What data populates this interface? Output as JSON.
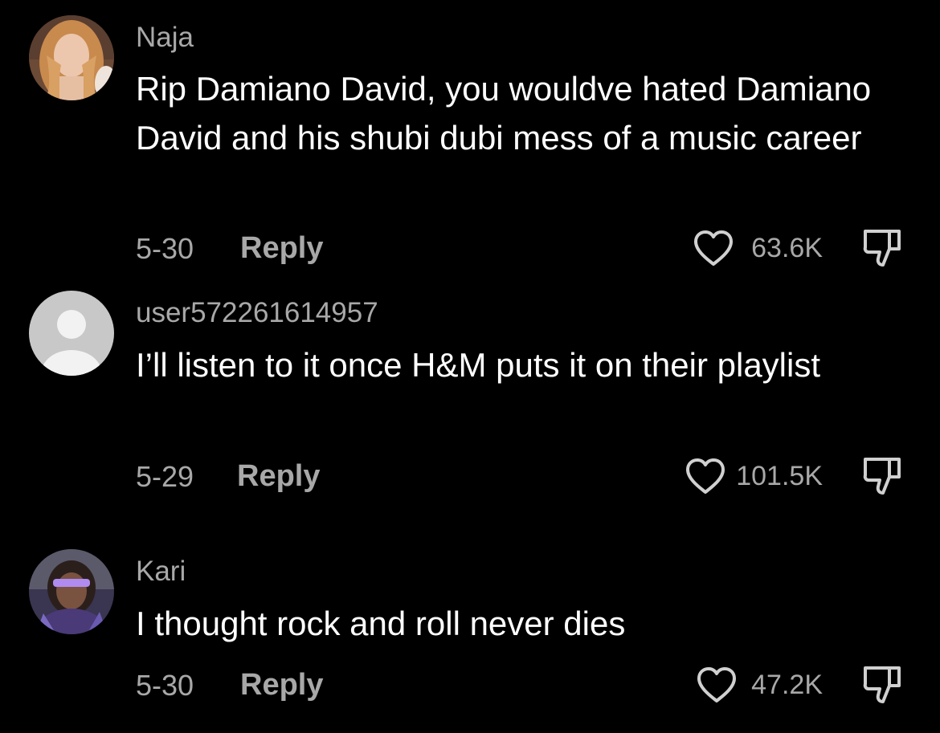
{
  "colors": {
    "background": "#000000",
    "text_primary": "#ffffff",
    "text_secondary": "#a8a8a8"
  },
  "comments": [
    {
      "username": "Naja",
      "text": "Rip Damiano David, you wouldve hated Damiano David and his shubi dubi mess of a music career",
      "date": "5-30",
      "reply_label": "Reply",
      "likes": "63.6K",
      "avatar": "photo-avatar"
    },
    {
      "username": "user572261614957",
      "text": "I’ll listen to it once H&M puts it on their playlist",
      "date": "5-29",
      "reply_label": "Reply",
      "likes": "101.5K",
      "avatar": "default-avatar"
    },
    {
      "username": "Kari",
      "text": "I thought rock and roll never dies",
      "date": "5-30",
      "reply_label": "Reply",
      "likes": "47.2K",
      "avatar": "photo-avatar"
    }
  ]
}
